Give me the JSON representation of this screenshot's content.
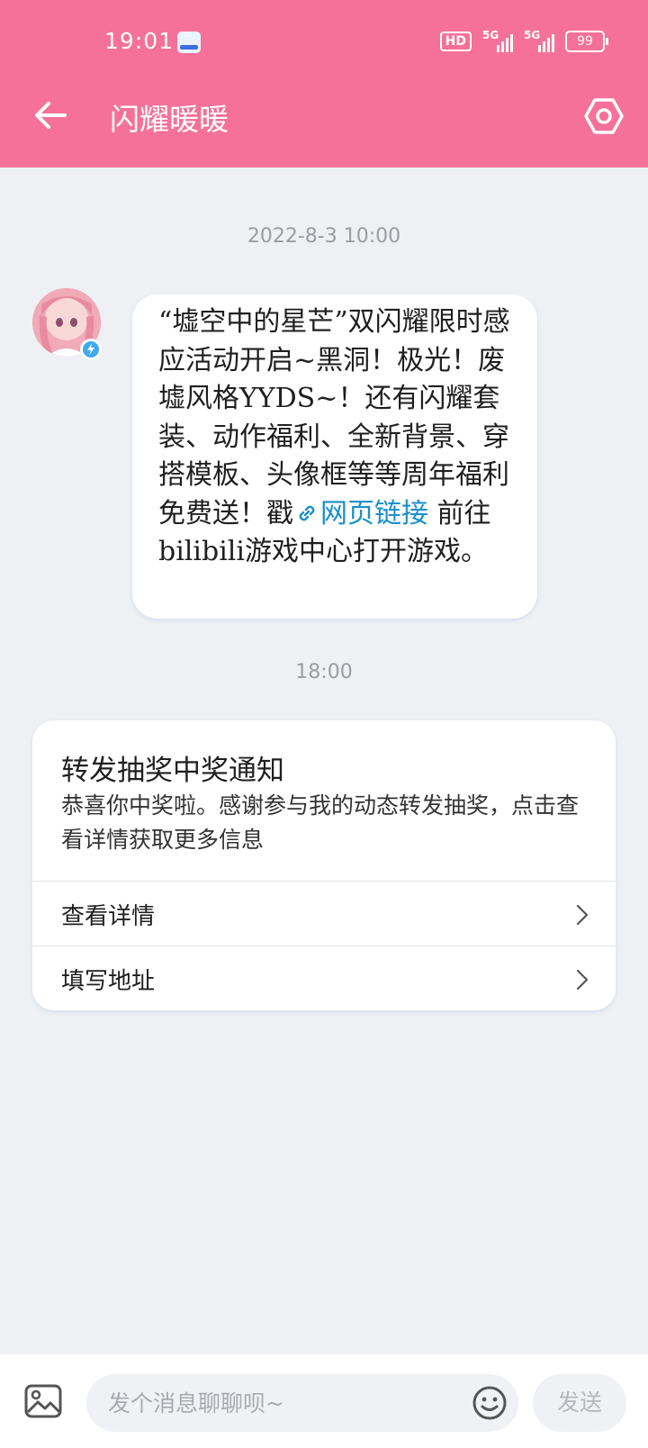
{
  "status_bar": {
    "time": "19:01",
    "hd_label": "HD",
    "network_1": "5G",
    "network_2": "5G",
    "battery": "99"
  },
  "header": {
    "title": "闪耀暖暖",
    "back_icon": "arrow-left-icon",
    "settings_icon": "hexagon-gear-icon",
    "bg_color": "#f67199"
  },
  "chat": {
    "timestamp_1": "2022-8-3 10:00",
    "message_1": {
      "text_before_link": "“墟空中的星芒”双闪耀限时感应活动开启~黑洞！极光！废墟风格YYDS~！还有闪耀套装、动作福利、全新背景、穿搭模板、头像框等等周年福利免费送！戳",
      "link_text": "网页链接",
      "text_after_link": " 前往bilibili游戏中心打开游戏。"
    },
    "timestamp_2": "18:00",
    "card": {
      "title": "转发抽奖中奖通知",
      "description": "恭喜你中奖啦。感谢参与我的动态转发抽奖，点击查看详情获取更多信息",
      "rows": [
        {
          "label": "查看详情"
        },
        {
          "label": "填写地址"
        }
      ]
    }
  },
  "composer": {
    "placeholder": "发个消息聊聊呗~",
    "value": "",
    "send_label": "发送"
  }
}
